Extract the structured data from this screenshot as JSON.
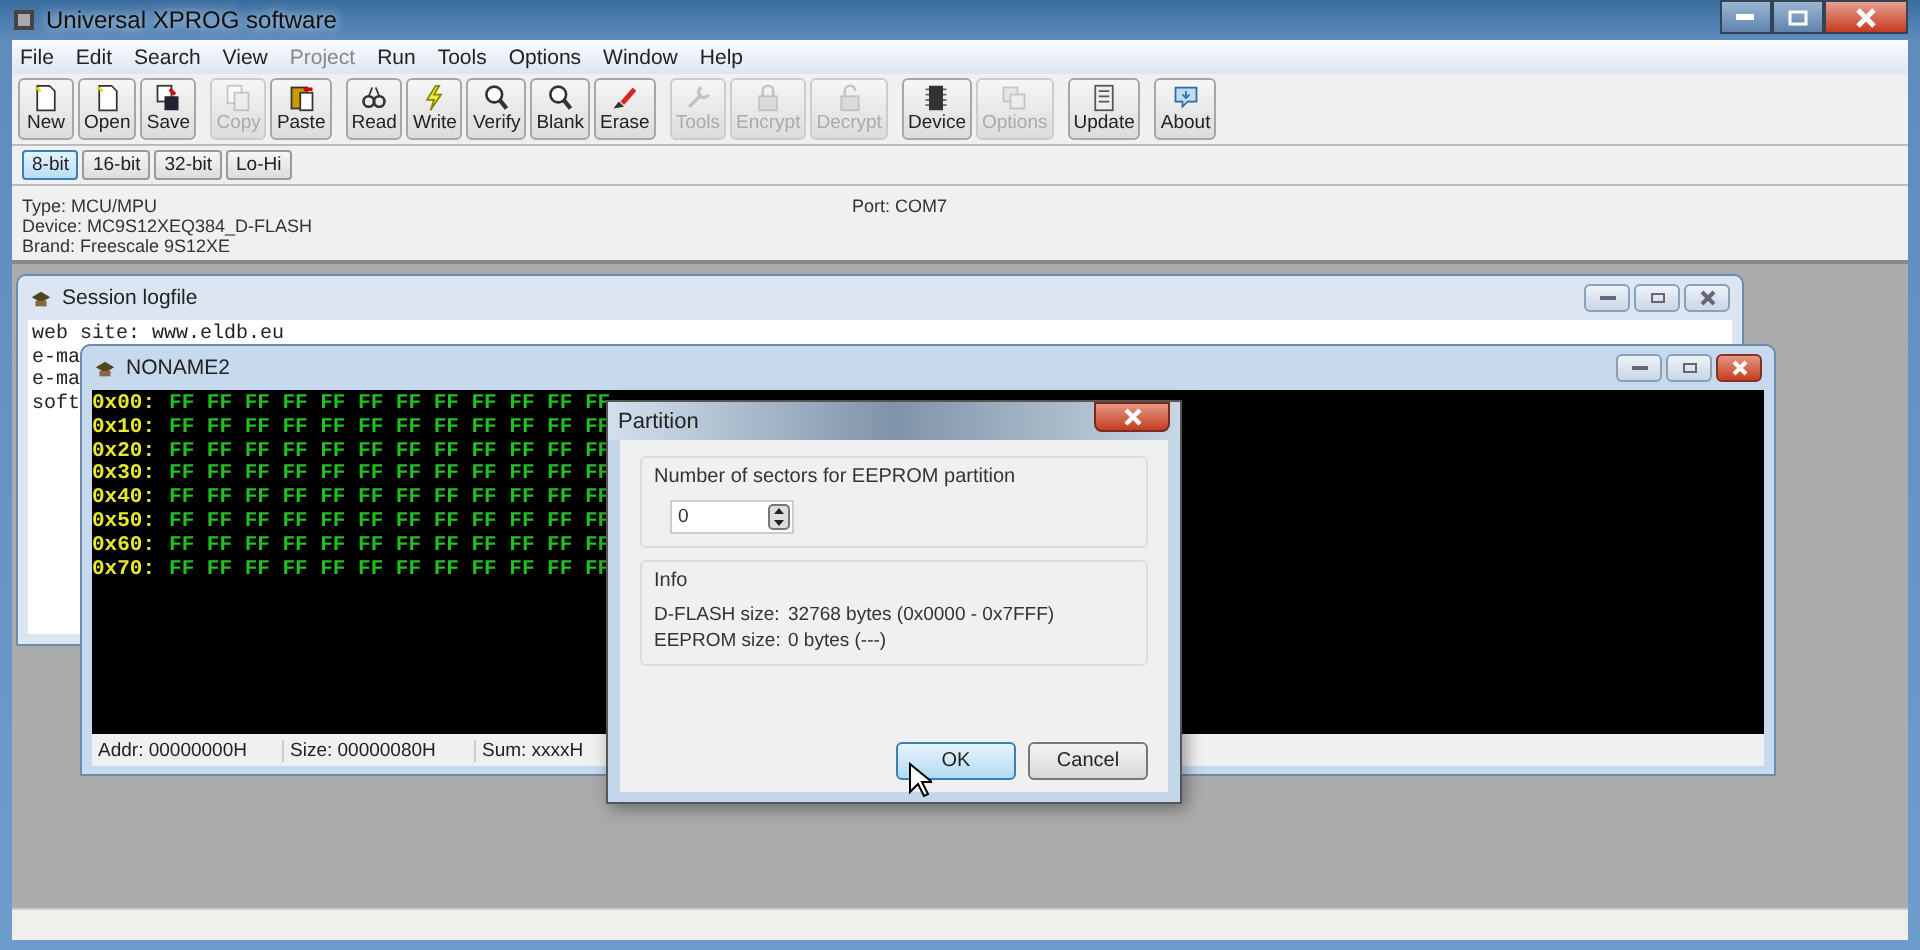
{
  "window": {
    "title": "Universal XPROG software"
  },
  "menu": [
    {
      "label": "File",
      "disabled": false
    },
    {
      "label": "Edit",
      "disabled": false
    },
    {
      "label": "Search",
      "disabled": false
    },
    {
      "label": "View",
      "disabled": false
    },
    {
      "label": "Project",
      "disabled": true
    },
    {
      "label": "Run",
      "disabled": false
    },
    {
      "label": "Tools",
      "disabled": false
    },
    {
      "label": "Options",
      "disabled": false
    },
    {
      "label": "Window",
      "disabled": false
    },
    {
      "label": "Help",
      "disabled": false
    }
  ],
  "toolbar": [
    [
      {
        "label": "New",
        "disabled": false
      },
      {
        "label": "Open",
        "disabled": false
      },
      {
        "label": "Save",
        "disabled": false
      }
    ],
    [
      {
        "label": "Copy",
        "disabled": true
      },
      {
        "label": "Paste",
        "disabled": false
      }
    ],
    [
      {
        "label": "Read",
        "disabled": false
      },
      {
        "label": "Write",
        "disabled": false
      },
      {
        "label": "Verify",
        "disabled": false
      },
      {
        "label": "Blank",
        "disabled": false
      },
      {
        "label": "Erase",
        "disabled": false
      }
    ],
    [
      {
        "label": "Tools",
        "disabled": true
      },
      {
        "label": "Encrypt",
        "disabled": true
      },
      {
        "label": "Decrypt",
        "disabled": true
      }
    ],
    [
      {
        "label": "Device",
        "disabled": false
      },
      {
        "label": "Options",
        "disabled": true
      }
    ],
    [
      {
        "label": "Update",
        "disabled": false
      }
    ],
    [
      {
        "label": "About",
        "disabled": false
      }
    ]
  ],
  "width_tabs": [
    {
      "label": "8-bit",
      "selected": true
    },
    {
      "label": "16-bit",
      "selected": false
    },
    {
      "label": "32-bit",
      "selected": false
    },
    {
      "label": "Lo-Hi",
      "selected": false
    }
  ],
  "info": {
    "lines": [
      "Type: MCU/MPU",
      "Device: MC9S12XEQ384_D-FLASH",
      "Brand: Freescale 9S12XE"
    ],
    "port": "Port: COM7"
  },
  "session_window": {
    "title": "Session logfile",
    "lines": [
      "web site: www.eldb.eu",
      "e-ma",
      "e-ma",
      "soft"
    ]
  },
  "hex_window": {
    "title": "NONAME2",
    "rows": [
      {
        "address": "0x00:",
        "bytes": "FF FF FF FF FF FF FF FF FF FF FF FF"
      },
      {
        "address": "0x10:",
        "bytes": "FF FF FF FF FF FF FF FF FF FF FF FF"
      },
      {
        "address": "0x20:",
        "bytes": "FF FF FF FF FF FF FF FF FF FF FF FF"
      },
      {
        "address": "0x30:",
        "bytes": "FF FF FF FF FF FF FF FF FF FF FF FF"
      },
      {
        "address": "0x40:",
        "bytes": "FF FF FF FF FF FF FF FF FF FF FF FF"
      },
      {
        "address": "0x50:",
        "bytes": "FF FF FF FF FF FF FF FF FF FF FF FF"
      },
      {
        "address": "0x60:",
        "bytes": "FF FF FF FF FF FF FF FF FF FF FF FF"
      },
      {
        "address": "0x70:",
        "bytes": "FF FF FF FF FF FF FF FF FF FF FF FF"
      }
    ],
    "status": [
      "Addr: 00000000H",
      "Size: 00000080H",
      "Sum: xxxxH"
    ]
  },
  "dialog": {
    "title": "Partition",
    "sectors_group": "Number of sectors for EEPROM partition",
    "sectors_value": "0",
    "info_group": "Info",
    "info_rows": [
      {
        "label": "D-FLASH size:",
        "value": "32768 bytes (0x0000 - 0x7FFF)"
      },
      {
        "label": "EEPROM size:",
        "value": "0 bytes (---)"
      }
    ],
    "buttons": [
      {
        "label": "OK",
        "focused": true
      },
      {
        "label": "Cancel",
        "focused": false
      }
    ]
  }
}
